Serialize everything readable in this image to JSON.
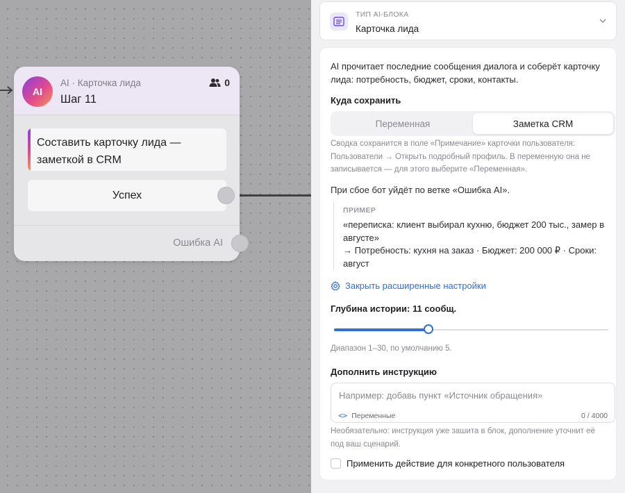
{
  "node": {
    "avatar": "AI",
    "kind": "AI · Карточка лида",
    "title": "Шаг 11",
    "users_icon": "users-icon",
    "users_count": "0",
    "task_line1": "Составить карточку лида —",
    "task_line2": "заметкой в CRM",
    "success_label": "Успех",
    "error_label": "Ошибка AI"
  },
  "panel": {
    "type_icon": "list-icon",
    "type_label": "ТИП AI-БЛОКА",
    "type_value": "Карточка лида",
    "description": "AI прочитает последние сообщения диалога и соберёт карточку лида: потребность, бюджет, сроки, контакты.",
    "save_heading": "Куда сохранить",
    "save_options": [
      "Переменная",
      "Заметка CRM"
    ],
    "save_selected": "Заметка CRM",
    "save_hint": "Сводка сохранится в поле «Примечание» карточки пользователя: Пользователи → Открыть подробный профиль. В переменную она не записывается — для этого выберите «Переменная».",
    "fallback_text": "При сбое бот уйдёт по ветке «Ошибка AI».",
    "example_label": "ПРИМЕР",
    "example_line1": "«переписка: клиент выбирал кухню, бюджет 200 тыс., замер в августе»",
    "example_line2": "→ Потребность: кухня на заказ · Бюджет: 200 000 ₽ · Сроки: август",
    "advanced_link": "Закрыть расширенные настройки",
    "depth_heading": "Глубина истории: 11 сообщ.",
    "depth_value": 11,
    "depth_min": 1,
    "depth_max": 30,
    "depth_hint": "Диапазон 1–30, по умолчанию 5.",
    "extra_heading": "Дополнить инструкцию",
    "extra_placeholder": "Например: добавь пункт «Источник обращения»",
    "extra_vars_label": "Переменные",
    "extra_counter": "0 / 4000",
    "extra_hint": "Необязательно: инструкция уже зашита в блок, дополнение уточнит её под ваш сценарий.",
    "apply_user_label": "Применить действие для конкретного пользователя",
    "apply_user_checked": false
  },
  "colors": {
    "accent": "#2f6fd8",
    "ai_gradient": [
      "#8b3ee0",
      "#e04a8c",
      "#f5955a"
    ]
  }
}
